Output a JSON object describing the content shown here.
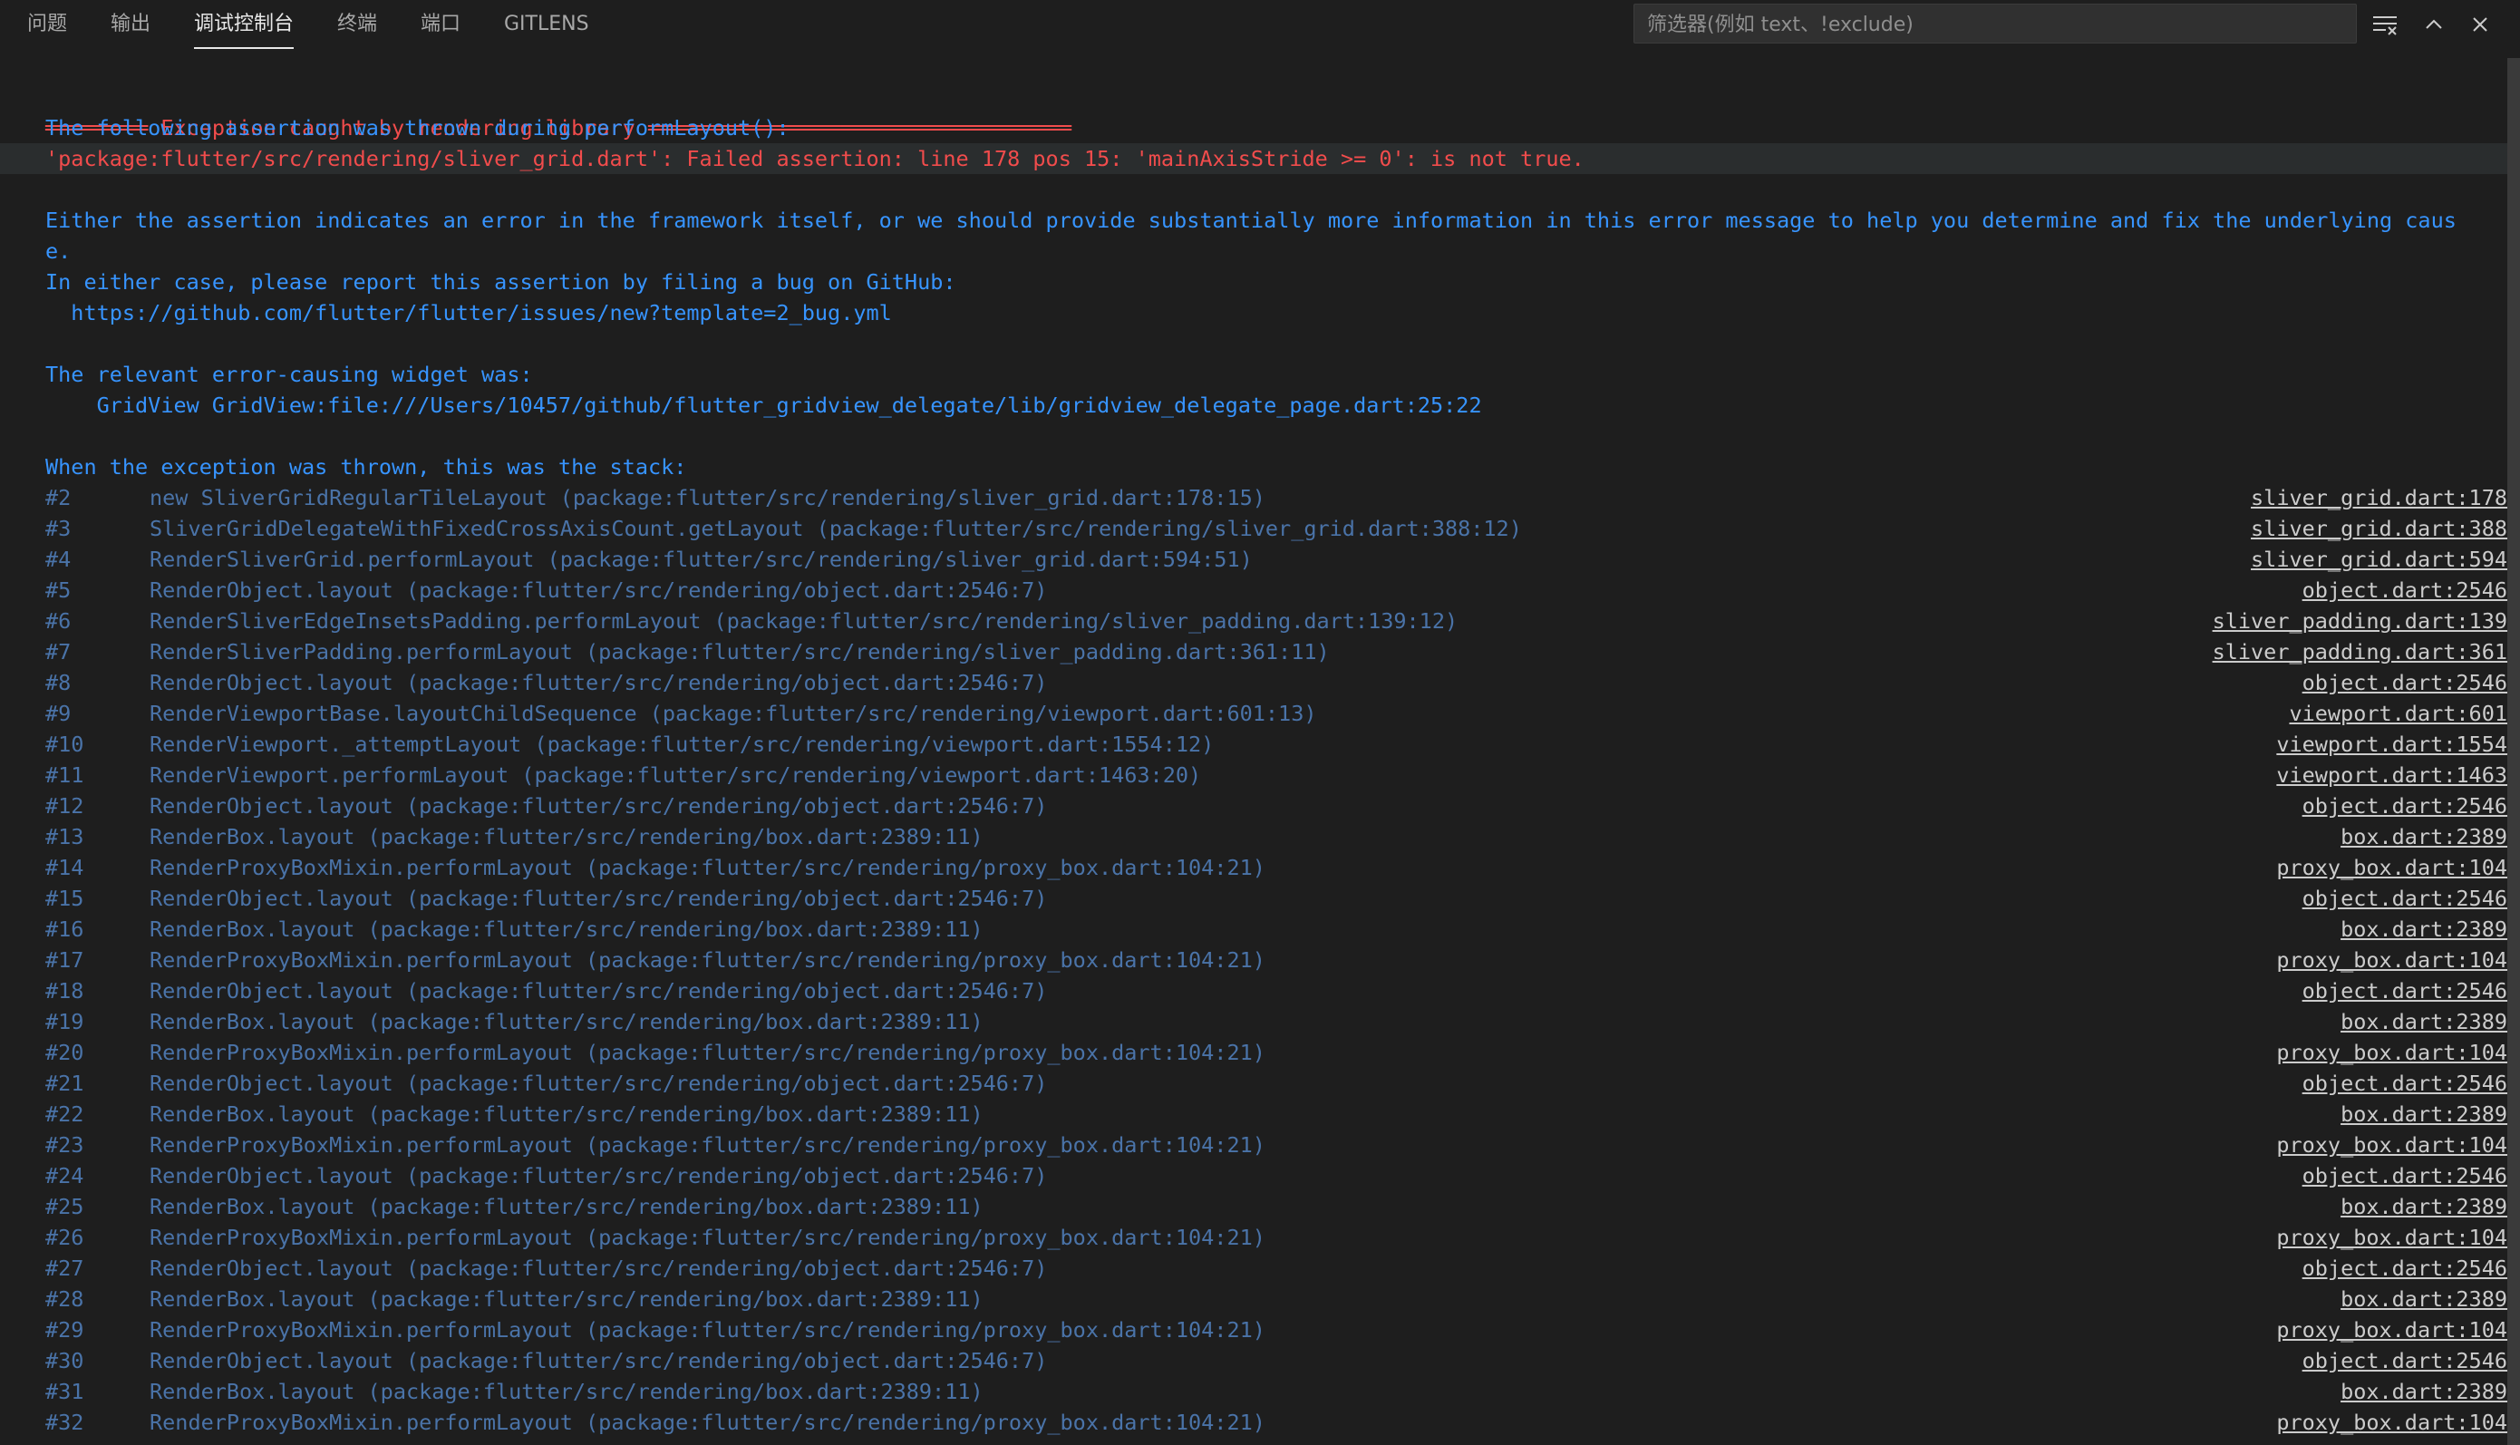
{
  "tabs": [
    {
      "label": "问题"
    },
    {
      "label": "输出"
    },
    {
      "label": "调试控制台"
    },
    {
      "label": "终端"
    },
    {
      "label": "端口"
    },
    {
      "label": "GITLENS"
    }
  ],
  "active_tab": "调试控制台",
  "filter": {
    "placeholder": "筛选器(例如 text、!exclude)",
    "value": ""
  },
  "toolbar_icons": [
    "clear-filter-icon",
    "chevron-up-icon",
    "close-icon"
  ],
  "colors": {
    "background": "#1e1e1e",
    "error_red": "#f14c4c",
    "info_blue": "#3794ff",
    "stack_dim": "#4a73a8",
    "link": "#cccccc"
  },
  "console": {
    "header": "════════ Exception caught by rendering library ═════════════════════════════════",
    "lines": [
      {
        "text": "The following assertion was thrown during performLayout():",
        "color": "blue"
      },
      {
        "text": "'package:flutter/src/rendering/sliver_grid.dart': Failed assertion: line 178 pos 15: 'mainAxisStride >= 0': is not true.",
        "color": "red"
      },
      {
        "text": "",
        "color": "blue"
      },
      {
        "text": "Either the assertion indicates an error in the framework itself, or we should provide substantially more information in this error message to help you determine and fix the underlying caus",
        "color": "blue"
      },
      {
        "text": "e.",
        "color": "blue"
      },
      {
        "text": "In either case, please report this assertion by filing a bug on GitHub:",
        "color": "blue"
      },
      {
        "text": "  https://github.com/flutter/flutter/issues/new?template=2_bug.yml",
        "color": "blue"
      },
      {
        "text": "",
        "color": "blue"
      },
      {
        "text": "The relevant error-causing widget was:",
        "color": "blue"
      },
      {
        "text": "    GridView GridView:file:///Users/10457/github/flutter_gridview_delegate/lib/gridview_delegate_page.dart:25:22",
        "color": "blue"
      },
      {
        "text": "",
        "color": "blue"
      },
      {
        "text": "When the exception was thrown, this was the stack:",
        "color": "blue"
      }
    ],
    "stack": [
      {
        "num": "#2",
        "frame": "new SliverGridRegularTileLayout (package:flutter/src/rendering/sliver_grid.dart:178:15)",
        "source": "sliver_grid.dart:178"
      },
      {
        "num": "#3",
        "frame": "SliverGridDelegateWithFixedCrossAxisCount.getLayout (package:flutter/src/rendering/sliver_grid.dart:388:12)",
        "source": "sliver_grid.dart:388"
      },
      {
        "num": "#4",
        "frame": "RenderSliverGrid.performLayout (package:flutter/src/rendering/sliver_grid.dart:594:51)",
        "source": "sliver_grid.dart:594"
      },
      {
        "num": "#5",
        "frame": "RenderObject.layout (package:flutter/src/rendering/object.dart:2546:7)",
        "source": "object.dart:2546"
      },
      {
        "num": "#6",
        "frame": "RenderSliverEdgeInsetsPadding.performLayout (package:flutter/src/rendering/sliver_padding.dart:139:12)",
        "source": "sliver_padding.dart:139"
      },
      {
        "num": "#7",
        "frame": "RenderSliverPadding.performLayout (package:flutter/src/rendering/sliver_padding.dart:361:11)",
        "source": "sliver_padding.dart:361"
      },
      {
        "num": "#8",
        "frame": "RenderObject.layout (package:flutter/src/rendering/object.dart:2546:7)",
        "source": "object.dart:2546"
      },
      {
        "num": "#9",
        "frame": "RenderViewportBase.layoutChildSequence (package:flutter/src/rendering/viewport.dart:601:13)",
        "source": "viewport.dart:601"
      },
      {
        "num": "#10",
        "frame": "RenderViewport._attemptLayout (package:flutter/src/rendering/viewport.dart:1554:12)",
        "source": "viewport.dart:1554"
      },
      {
        "num": "#11",
        "frame": "RenderViewport.performLayout (package:flutter/src/rendering/viewport.dart:1463:20)",
        "source": "viewport.dart:1463"
      },
      {
        "num": "#12",
        "frame": "RenderObject.layout (package:flutter/src/rendering/object.dart:2546:7)",
        "source": "object.dart:2546"
      },
      {
        "num": "#13",
        "frame": "RenderBox.layout (package:flutter/src/rendering/box.dart:2389:11)",
        "source": "box.dart:2389"
      },
      {
        "num": "#14",
        "frame": "RenderProxyBoxMixin.performLayout (package:flutter/src/rendering/proxy_box.dart:104:21)",
        "source": "proxy_box.dart:104"
      },
      {
        "num": "#15",
        "frame": "RenderObject.layout (package:flutter/src/rendering/object.dart:2546:7)",
        "source": "object.dart:2546"
      },
      {
        "num": "#16",
        "frame": "RenderBox.layout (package:flutter/src/rendering/box.dart:2389:11)",
        "source": "box.dart:2389"
      },
      {
        "num": "#17",
        "frame": "RenderProxyBoxMixin.performLayout (package:flutter/src/rendering/proxy_box.dart:104:21)",
        "source": "proxy_box.dart:104"
      },
      {
        "num": "#18",
        "frame": "RenderObject.layout (package:flutter/src/rendering/object.dart:2546:7)",
        "source": "object.dart:2546"
      },
      {
        "num": "#19",
        "frame": "RenderBox.layout (package:flutter/src/rendering/box.dart:2389:11)",
        "source": "box.dart:2389"
      },
      {
        "num": "#20",
        "frame": "RenderProxyBoxMixin.performLayout (package:flutter/src/rendering/proxy_box.dart:104:21)",
        "source": "proxy_box.dart:104"
      },
      {
        "num": "#21",
        "frame": "RenderObject.layout (package:flutter/src/rendering/object.dart:2546:7)",
        "source": "object.dart:2546"
      },
      {
        "num": "#22",
        "frame": "RenderBox.layout (package:flutter/src/rendering/box.dart:2389:11)",
        "source": "box.dart:2389"
      },
      {
        "num": "#23",
        "frame": "RenderProxyBoxMixin.performLayout (package:flutter/src/rendering/proxy_box.dart:104:21)",
        "source": "proxy_box.dart:104"
      },
      {
        "num": "#24",
        "frame": "RenderObject.layout (package:flutter/src/rendering/object.dart:2546:7)",
        "source": "object.dart:2546"
      },
      {
        "num": "#25",
        "frame": "RenderBox.layout (package:flutter/src/rendering/box.dart:2389:11)",
        "source": "box.dart:2389"
      },
      {
        "num": "#26",
        "frame": "RenderProxyBoxMixin.performLayout (package:flutter/src/rendering/proxy_box.dart:104:21)",
        "source": "proxy_box.dart:104"
      },
      {
        "num": "#27",
        "frame": "RenderObject.layout (package:flutter/src/rendering/object.dart:2546:7)",
        "source": "object.dart:2546"
      },
      {
        "num": "#28",
        "frame": "RenderBox.layout (package:flutter/src/rendering/box.dart:2389:11)",
        "source": "box.dart:2389"
      },
      {
        "num": "#29",
        "frame": "RenderProxyBoxMixin.performLayout (package:flutter/src/rendering/proxy_box.dart:104:21)",
        "source": "proxy_box.dart:104"
      },
      {
        "num": "#30",
        "frame": "RenderObject.layout (package:flutter/src/rendering/object.dart:2546:7)",
        "source": "object.dart:2546"
      },
      {
        "num": "#31",
        "frame": "RenderBox.layout (package:flutter/src/rendering/box.dart:2389:11)",
        "source": "box.dart:2389"
      },
      {
        "num": "#32",
        "frame": "RenderProxyBoxMixin.performLayout (package:flutter/src/rendering/proxy_box.dart:104:21)",
        "source": "proxy_box.dart:104"
      }
    ]
  }
}
